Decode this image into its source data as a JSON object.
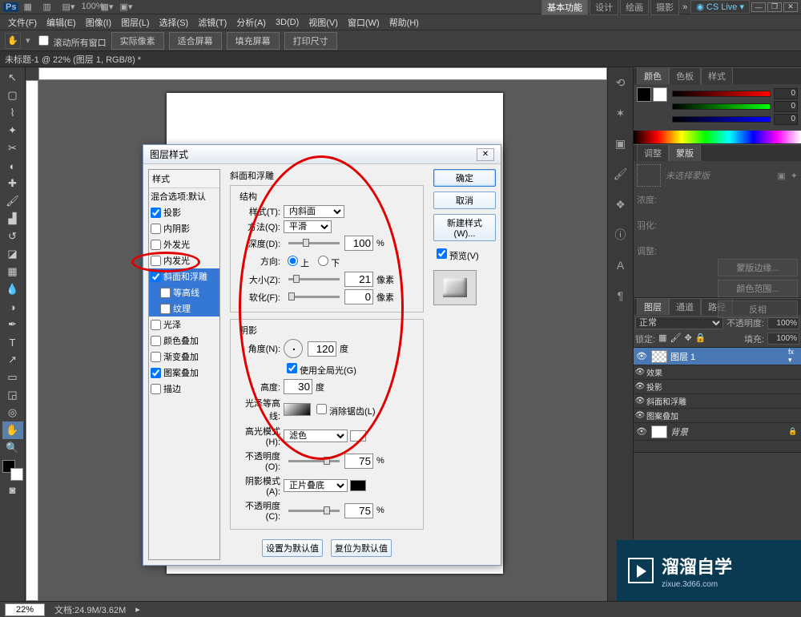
{
  "titlebar": {
    "app": "Ps",
    "workspace_tabs": [
      "基本功能",
      "设计",
      "绘画",
      "摄影"
    ],
    "cslive": "CS Live"
  },
  "menubar": [
    "文件(F)",
    "编辑(E)",
    "图像(I)",
    "图层(L)",
    "选择(S)",
    "滤镜(T)",
    "分析(A)",
    "3D(D)",
    "视图(V)",
    "窗口(W)",
    "帮助(H)"
  ],
  "optbar": {
    "scroll_all": "滚动所有窗口",
    "buttons": [
      "实际像素",
      "适合屏幕",
      "填充屏幕",
      "打印尺寸"
    ],
    "zoom": "100%"
  },
  "doctab": "未标题-1 @ 22% (图层 1, RGB/8) *",
  "color_panel": {
    "tabs": [
      "颜色",
      "色板",
      "样式"
    ],
    "r": "0",
    "g": "0",
    "b": "0"
  },
  "adjust_panel": {
    "tabs": [
      "调整",
      "蒙版"
    ],
    "placeholder": "未选择蒙版",
    "density_label": "浓度:",
    "feather_label": "羽化:",
    "refine_label": "调整:",
    "mask_edge": "蒙版边缘...",
    "color_range": "颜色范围...",
    "invert": "反相"
  },
  "layer_panel": {
    "tabs": [
      "图层",
      "通道",
      "路径"
    ],
    "blend": "正常",
    "opacity_label": "不透明度:",
    "opacity": "100%",
    "lock_label": "锁定:",
    "fill_label": "填充:",
    "fill": "100%",
    "layers": [
      {
        "name": "图层 1",
        "sel": true,
        "fx": true
      },
      {
        "effects_header": "效果"
      },
      {
        "effect": "投影"
      },
      {
        "effect": "斜面和浮雕"
      },
      {
        "effect": "图案叠加"
      },
      {
        "name": "背景",
        "locked": true,
        "italic": true
      }
    ]
  },
  "dialog": {
    "title": "图层样式",
    "list_header": "样式",
    "blend_opts": "混合选项:默认",
    "items": [
      {
        "label": "投影",
        "checked": true
      },
      {
        "label": "内阴影",
        "checked": false
      },
      {
        "label": "外发光",
        "checked": false
      },
      {
        "label": "内发光",
        "checked": false
      },
      {
        "label": "斜面和浮雕",
        "checked": true,
        "sel": true
      },
      {
        "label": "等高线",
        "checked": false,
        "sub": true,
        "sel": true
      },
      {
        "label": "纹理",
        "checked": false,
        "sub": true,
        "sel": true
      },
      {
        "label": "光泽",
        "checked": false
      },
      {
        "label": "颜色叠加",
        "checked": false
      },
      {
        "label": "渐变叠加",
        "checked": false
      },
      {
        "label": "图案叠加",
        "checked": true
      },
      {
        "label": "描边",
        "checked": false
      }
    ],
    "section_title": "斜面和浮雕",
    "structure": {
      "legend": "结构",
      "style_label": "样式(T):",
      "style": "内斜面",
      "tech_label": "方法(Q):",
      "tech": "平滑",
      "depth_label": "深度(D):",
      "depth": "100",
      "depth_unit": "%",
      "dir_label": "方向:",
      "up": "上",
      "down": "下",
      "size_label": "大小(Z):",
      "size": "21",
      "size_unit": "像素",
      "soften_label": "软化(F):",
      "soften": "0",
      "soften_unit": "像素"
    },
    "shading": {
      "legend": "阴影",
      "angle_label": "角度(N):",
      "angle": "120",
      "angle_unit": "度",
      "global": "使用全局光(G)",
      "alt_label": "高度:",
      "alt": "30",
      "alt_unit": "度",
      "gloss_label": "光泽等高线:",
      "anti": "消除锯齿(L)",
      "hmode_label": "高光模式(H):",
      "hmode": "滤色",
      "hopac_label": "不透明度(O):",
      "hopac": "75",
      "pct": "%",
      "smode_label": "阴影模式(A):",
      "smode": "正片叠底",
      "sopac_label": "不透明度(C):",
      "sopac": "75"
    },
    "make_default": "设置为默认值",
    "reset_default": "复位为默认值",
    "ok": "确定",
    "cancel": "取消",
    "new_style": "新建样式(W)...",
    "preview": "预览(V)"
  },
  "status": {
    "zoom": "22%",
    "docinfo": "文档:24.9M/3.62M"
  },
  "watermark": {
    "title": "溜溜自学",
    "sub": "zixue.3d66.com"
  }
}
